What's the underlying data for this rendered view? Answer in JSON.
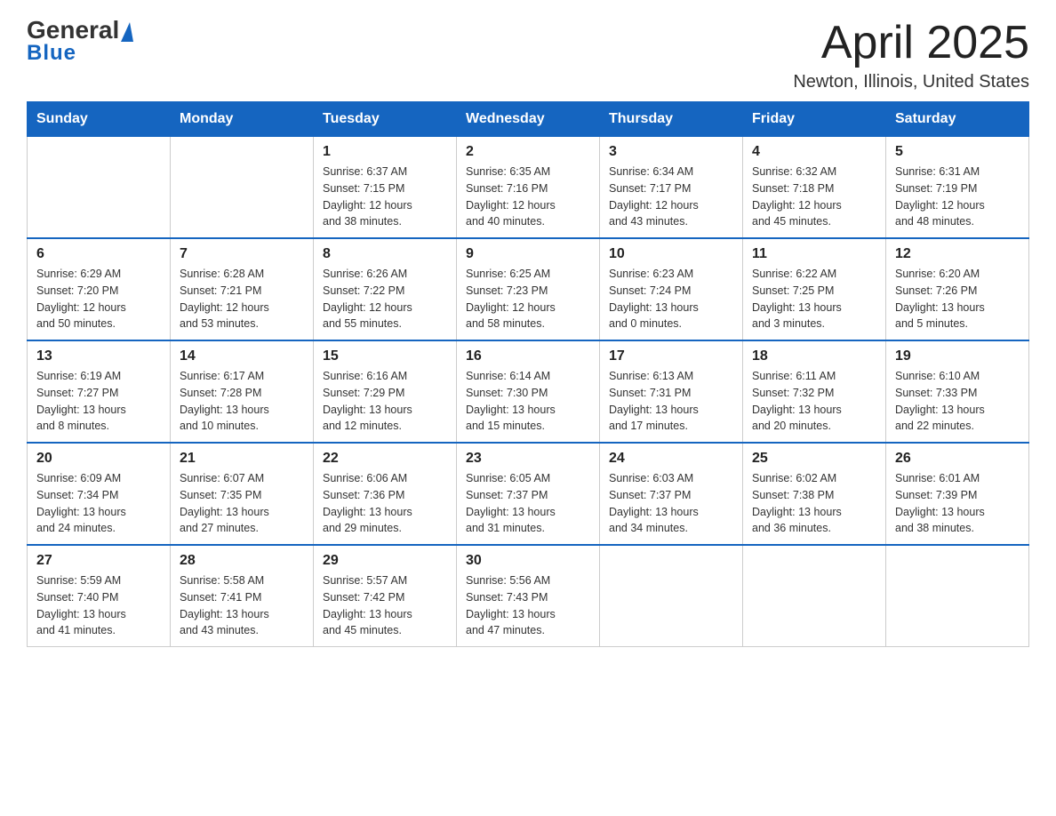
{
  "header": {
    "logo_general": "General",
    "logo_blue": "Blue",
    "title": "April 2025",
    "subtitle": "Newton, Illinois, United States"
  },
  "days_of_week": [
    "Sunday",
    "Monday",
    "Tuesday",
    "Wednesday",
    "Thursday",
    "Friday",
    "Saturday"
  ],
  "weeks": [
    [
      {
        "day": "",
        "info": ""
      },
      {
        "day": "",
        "info": ""
      },
      {
        "day": "1",
        "info": "Sunrise: 6:37 AM\nSunset: 7:15 PM\nDaylight: 12 hours\nand 38 minutes."
      },
      {
        "day": "2",
        "info": "Sunrise: 6:35 AM\nSunset: 7:16 PM\nDaylight: 12 hours\nand 40 minutes."
      },
      {
        "day": "3",
        "info": "Sunrise: 6:34 AM\nSunset: 7:17 PM\nDaylight: 12 hours\nand 43 minutes."
      },
      {
        "day": "4",
        "info": "Sunrise: 6:32 AM\nSunset: 7:18 PM\nDaylight: 12 hours\nand 45 minutes."
      },
      {
        "day": "5",
        "info": "Sunrise: 6:31 AM\nSunset: 7:19 PM\nDaylight: 12 hours\nand 48 minutes."
      }
    ],
    [
      {
        "day": "6",
        "info": "Sunrise: 6:29 AM\nSunset: 7:20 PM\nDaylight: 12 hours\nand 50 minutes."
      },
      {
        "day": "7",
        "info": "Sunrise: 6:28 AM\nSunset: 7:21 PM\nDaylight: 12 hours\nand 53 minutes."
      },
      {
        "day": "8",
        "info": "Sunrise: 6:26 AM\nSunset: 7:22 PM\nDaylight: 12 hours\nand 55 minutes."
      },
      {
        "day": "9",
        "info": "Sunrise: 6:25 AM\nSunset: 7:23 PM\nDaylight: 12 hours\nand 58 minutes."
      },
      {
        "day": "10",
        "info": "Sunrise: 6:23 AM\nSunset: 7:24 PM\nDaylight: 13 hours\nand 0 minutes."
      },
      {
        "day": "11",
        "info": "Sunrise: 6:22 AM\nSunset: 7:25 PM\nDaylight: 13 hours\nand 3 minutes."
      },
      {
        "day": "12",
        "info": "Sunrise: 6:20 AM\nSunset: 7:26 PM\nDaylight: 13 hours\nand 5 minutes."
      }
    ],
    [
      {
        "day": "13",
        "info": "Sunrise: 6:19 AM\nSunset: 7:27 PM\nDaylight: 13 hours\nand 8 minutes."
      },
      {
        "day": "14",
        "info": "Sunrise: 6:17 AM\nSunset: 7:28 PM\nDaylight: 13 hours\nand 10 minutes."
      },
      {
        "day": "15",
        "info": "Sunrise: 6:16 AM\nSunset: 7:29 PM\nDaylight: 13 hours\nand 12 minutes."
      },
      {
        "day": "16",
        "info": "Sunrise: 6:14 AM\nSunset: 7:30 PM\nDaylight: 13 hours\nand 15 minutes."
      },
      {
        "day": "17",
        "info": "Sunrise: 6:13 AM\nSunset: 7:31 PM\nDaylight: 13 hours\nand 17 minutes."
      },
      {
        "day": "18",
        "info": "Sunrise: 6:11 AM\nSunset: 7:32 PM\nDaylight: 13 hours\nand 20 minutes."
      },
      {
        "day": "19",
        "info": "Sunrise: 6:10 AM\nSunset: 7:33 PM\nDaylight: 13 hours\nand 22 minutes."
      }
    ],
    [
      {
        "day": "20",
        "info": "Sunrise: 6:09 AM\nSunset: 7:34 PM\nDaylight: 13 hours\nand 24 minutes."
      },
      {
        "day": "21",
        "info": "Sunrise: 6:07 AM\nSunset: 7:35 PM\nDaylight: 13 hours\nand 27 minutes."
      },
      {
        "day": "22",
        "info": "Sunrise: 6:06 AM\nSunset: 7:36 PM\nDaylight: 13 hours\nand 29 minutes."
      },
      {
        "day": "23",
        "info": "Sunrise: 6:05 AM\nSunset: 7:37 PM\nDaylight: 13 hours\nand 31 minutes."
      },
      {
        "day": "24",
        "info": "Sunrise: 6:03 AM\nSunset: 7:37 PM\nDaylight: 13 hours\nand 34 minutes."
      },
      {
        "day": "25",
        "info": "Sunrise: 6:02 AM\nSunset: 7:38 PM\nDaylight: 13 hours\nand 36 minutes."
      },
      {
        "day": "26",
        "info": "Sunrise: 6:01 AM\nSunset: 7:39 PM\nDaylight: 13 hours\nand 38 minutes."
      }
    ],
    [
      {
        "day": "27",
        "info": "Sunrise: 5:59 AM\nSunset: 7:40 PM\nDaylight: 13 hours\nand 41 minutes."
      },
      {
        "day": "28",
        "info": "Sunrise: 5:58 AM\nSunset: 7:41 PM\nDaylight: 13 hours\nand 43 minutes."
      },
      {
        "day": "29",
        "info": "Sunrise: 5:57 AM\nSunset: 7:42 PM\nDaylight: 13 hours\nand 45 minutes."
      },
      {
        "day": "30",
        "info": "Sunrise: 5:56 AM\nSunset: 7:43 PM\nDaylight: 13 hours\nand 47 minutes."
      },
      {
        "day": "",
        "info": ""
      },
      {
        "day": "",
        "info": ""
      },
      {
        "day": "",
        "info": ""
      }
    ]
  ]
}
